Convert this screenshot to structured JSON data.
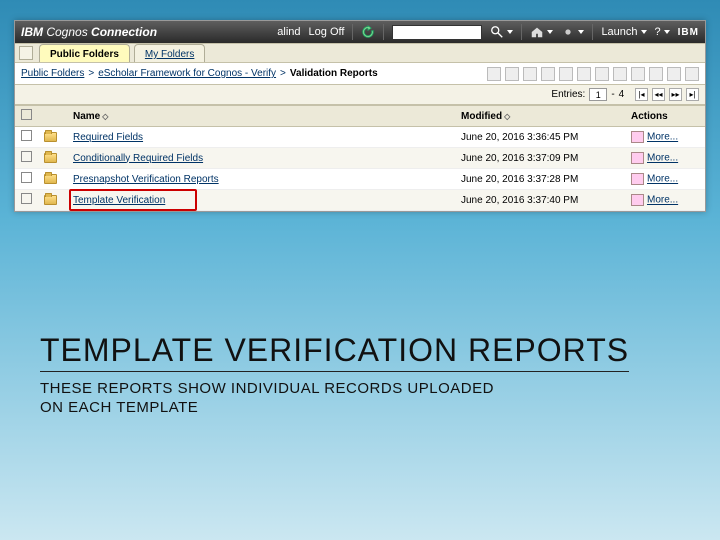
{
  "topbar": {
    "brand_prefix": "IBM",
    "brand_mid": " Cognos ",
    "brand_suffix": "Connection",
    "username": "alind",
    "logoff": "Log Off",
    "refresh_icon": "refresh-icon",
    "search_placeholder": "",
    "launch": "Launch",
    "help": "?",
    "ibm_mark": "IBM"
  },
  "tabs": {
    "public": "Public Folders",
    "my": "My Folders"
  },
  "breadcrumb": {
    "root": "Public Folders",
    "sep": ">",
    "mid": "eScholar Framework for Cognos - Verify",
    "current": "Validation Reports"
  },
  "entries": {
    "label": "Entries:",
    "from": "1",
    "dash": "-",
    "to": "4"
  },
  "columns": {
    "name": "Name",
    "modified": "Modified",
    "actions": "Actions"
  },
  "rows": [
    {
      "name": "Required Fields",
      "modified": "June 20, 2016 3:36:45 PM",
      "more": "More..."
    },
    {
      "name": "Conditionally Required Fields",
      "modified": "June 20, 2016 3:37:09 PM",
      "more": "More..."
    },
    {
      "name": "Presnapshot Verification Reports",
      "modified": "June 20, 2016 3:37:28 PM",
      "more": "More..."
    },
    {
      "name": "Template Verification",
      "modified": "June 20, 2016 3:37:40 PM",
      "more": "More...",
      "highlight": true
    }
  ],
  "slide": {
    "title": "TEMPLATE VERIFICATION REPORTS",
    "subtitle": "THESE REPORTS SHOW INDIVIDUAL RECORDS UPLOADED ON EACH TEMPLATE"
  }
}
